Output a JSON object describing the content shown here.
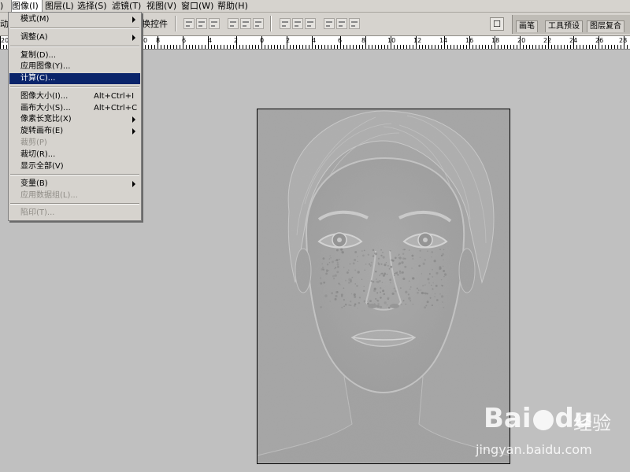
{
  "menubar": {
    "items": [
      {
        "label": ")"
      },
      {
        "label": "图像(I)"
      },
      {
        "label": "图层(L)"
      },
      {
        "label": "选择(S)"
      },
      {
        "label": "滤镜(T)"
      },
      {
        "label": "视图(V)"
      },
      {
        "label": "窗口(W)"
      },
      {
        "label": "帮助(H)"
      }
    ]
  },
  "toolbar": {
    "left_fragment": "动",
    "transform_controls": "换控件"
  },
  "palette_tabs": [
    "画笔",
    "工具预设",
    "图层复合"
  ],
  "ruler": {
    "labels": [
      "20",
      "0",
      "8",
      "6",
      "4",
      "2",
      "0",
      "2",
      "4",
      "6",
      "8",
      "10",
      "12",
      "14",
      "16",
      "18",
      "20",
      "22",
      "24",
      "26",
      "28"
    ]
  },
  "image_menu": {
    "items": [
      {
        "label": "模式(M)",
        "shortcut": "",
        "submenu": true,
        "disabled": false,
        "highlight": false
      },
      {
        "label": "调整(A)",
        "shortcut": "",
        "submenu": true,
        "disabled": false,
        "highlight": false
      },
      {
        "label": "复制(D)...",
        "shortcut": "",
        "submenu": false,
        "disabled": false,
        "highlight": false
      },
      {
        "label": "应用图像(Y)...",
        "shortcut": "",
        "submenu": false,
        "disabled": false,
        "highlight": false
      },
      {
        "label": "计算(C)...",
        "shortcut": "",
        "submenu": false,
        "disabled": false,
        "highlight": true
      },
      {
        "label": "图像大小(I)...",
        "shortcut": "Alt+Ctrl+I",
        "submenu": false,
        "disabled": false,
        "highlight": false
      },
      {
        "label": "画布大小(S)...",
        "shortcut": "Alt+Ctrl+C",
        "submenu": false,
        "disabled": false,
        "highlight": false
      },
      {
        "label": "像素长宽比(X)",
        "shortcut": "",
        "submenu": true,
        "disabled": false,
        "highlight": false
      },
      {
        "label": "旋转画布(E)",
        "shortcut": "",
        "submenu": true,
        "disabled": false,
        "highlight": false
      },
      {
        "label": "裁剪(P)",
        "shortcut": "",
        "submenu": false,
        "disabled": true,
        "highlight": false
      },
      {
        "label": "裁切(R)...",
        "shortcut": "",
        "submenu": false,
        "disabled": false,
        "highlight": false
      },
      {
        "label": "显示全部(V)",
        "shortcut": "",
        "submenu": false,
        "disabled": false,
        "highlight": false
      },
      {
        "label": "变量(B)",
        "shortcut": "",
        "submenu": true,
        "disabled": false,
        "highlight": false
      },
      {
        "label": "应用数据组(L)...",
        "shortcut": "",
        "submenu": false,
        "disabled": true,
        "highlight": false
      },
      {
        "label": "陷印(T)...",
        "shortcut": "",
        "submenu": false,
        "disabled": true,
        "highlight": false
      }
    ]
  },
  "watermark": {
    "logo_text": "Bai",
    "logo_suffix": "du",
    "brand": "经验",
    "url": "jingyan.baidu.com"
  },
  "colors": {
    "chrome": "#d6d3ce",
    "workspace": "#c0c0c0",
    "highlight": "#0a246a"
  }
}
